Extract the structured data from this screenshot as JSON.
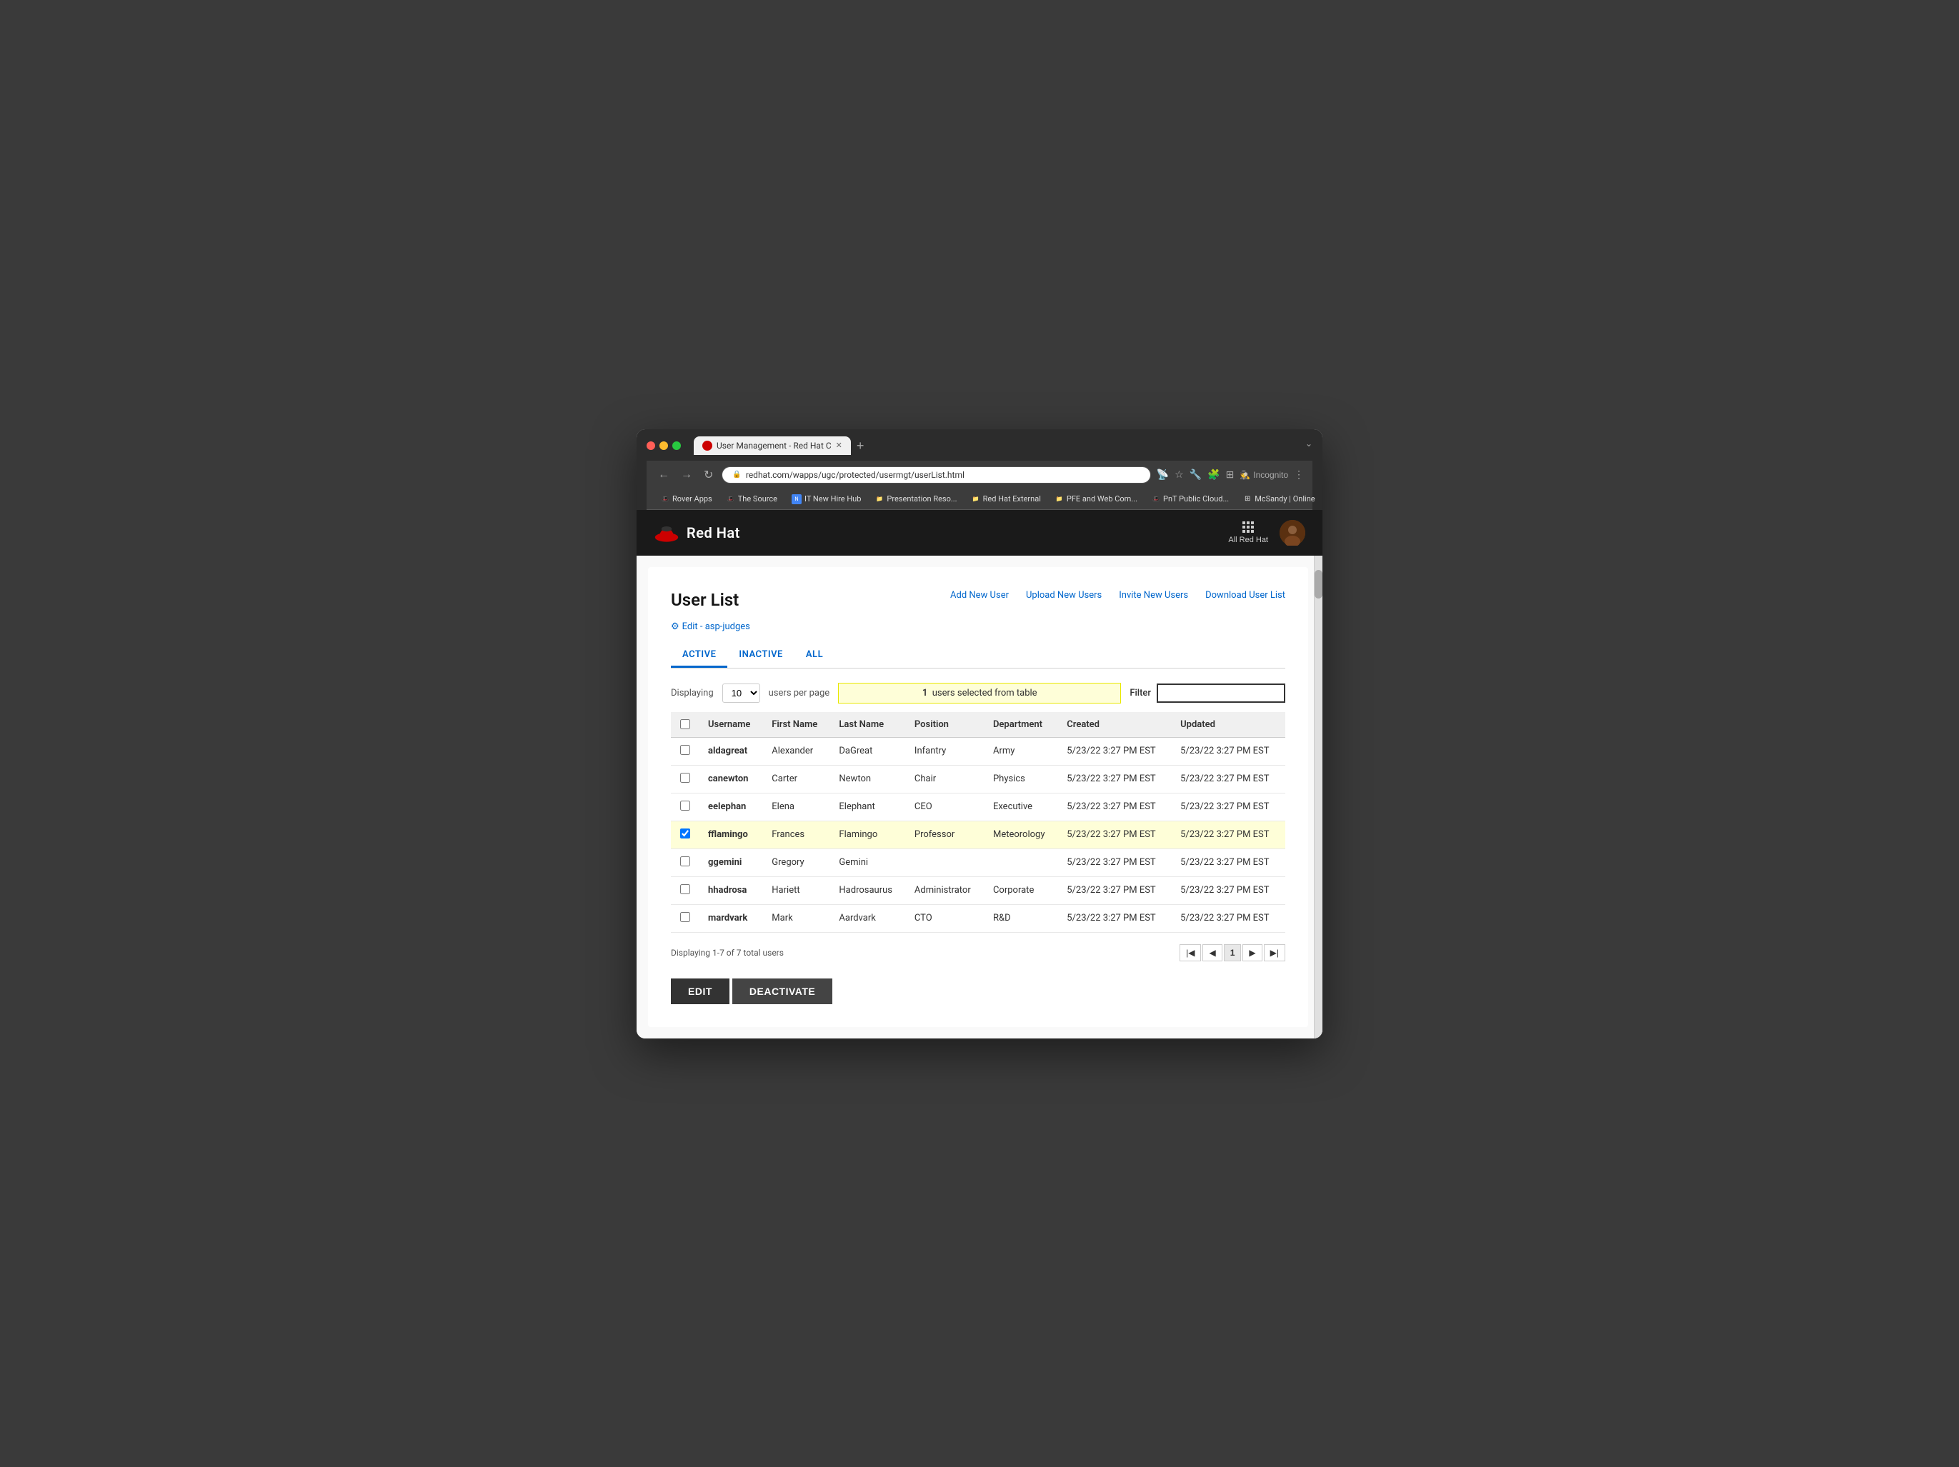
{
  "browser": {
    "tab_title": "User Management - Red Hat C",
    "url": "redhat.com/wapps/ugc/protected/usermgt/userList.html",
    "incognito_label": "Incognito",
    "bookmarks": [
      {
        "label": "Rover Apps",
        "type": "favicon-red"
      },
      {
        "label": "The Source",
        "type": "favicon-red"
      },
      {
        "label": "IT New Hire Hub",
        "type": "new"
      },
      {
        "label": "Presentation Reso...",
        "type": "folder"
      },
      {
        "label": "Red Hat External",
        "type": "folder"
      },
      {
        "label": "PFE and Web Com...",
        "type": "folder"
      },
      {
        "label": "PnT Public Cloud...",
        "type": "favicon-red"
      },
      {
        "label": "McSandy | Online",
        "type": "grid"
      }
    ]
  },
  "header": {
    "logo_text": "Red Hat",
    "all_red_hat_label": "All Red Hat"
  },
  "page": {
    "title": "User List",
    "edit_link": "Edit - asp-judges",
    "action_links": {
      "add": "Add New User",
      "upload": "Upload New Users",
      "invite": "Invite New Users",
      "download": "Download User List"
    },
    "tabs": [
      {
        "label": "ACTIVE",
        "active": true
      },
      {
        "label": "INACTIVE",
        "active": false
      },
      {
        "label": "ALL",
        "active": false
      }
    ]
  },
  "table": {
    "display_label": "Displaying",
    "per_page_value": "10",
    "users_per_page_label": "users per page",
    "selected_banner": "1  users selected from table",
    "filter_label": "Filter",
    "columns": [
      "Username",
      "First Name",
      "Last Name",
      "Position",
      "Department",
      "Created",
      "Updated"
    ],
    "rows": [
      {
        "username": "aldagreat",
        "first": "Alexander",
        "last": "DaGreat",
        "position": "Infantry",
        "department": "Army",
        "created": "5/23/22 3:27 PM EST",
        "updated": "5/23/22 3:27 PM EST",
        "selected": false
      },
      {
        "username": "canewton",
        "first": "Carter",
        "last": "Newton",
        "position": "Chair",
        "department": "Physics",
        "created": "5/23/22 3:27 PM EST",
        "updated": "5/23/22 3:27 PM EST",
        "selected": false
      },
      {
        "username": "eelephan",
        "first": "Elena",
        "last": "Elephant",
        "position": "CEO",
        "department": "Executive",
        "created": "5/23/22 3:27 PM EST",
        "updated": "5/23/22 3:27 PM EST",
        "selected": false
      },
      {
        "username": "fflamingo",
        "first": "Frances",
        "last": "Flamingo",
        "position": "Professor",
        "department": "Meteorology",
        "created": "5/23/22 3:27 PM EST",
        "updated": "5/23/22 3:27 PM EST",
        "selected": true
      },
      {
        "username": "ggemini",
        "first": "Gregory",
        "last": "Gemini",
        "position": "",
        "department": "",
        "created": "5/23/22 3:27 PM EST",
        "updated": "5/23/22 3:27 PM EST",
        "selected": false
      },
      {
        "username": "hhadrosa",
        "first": "Hariett",
        "last": "Hadrosaurus",
        "position": "Administrator",
        "department": "Corporate",
        "created": "5/23/22 3:27 PM EST",
        "updated": "5/23/22 3:27 PM EST",
        "selected": false
      },
      {
        "username": "mardvark",
        "first": "Mark",
        "last": "Aardvark",
        "position": "CTO",
        "department": "R&D",
        "created": "5/23/22 3:27 PM EST",
        "updated": "5/23/22 3:27 PM EST",
        "selected": false
      }
    ],
    "pagination_info": "Displaying 1-7 of 7 total users",
    "current_page": "1"
  },
  "buttons": {
    "edit": "EDIT",
    "deactivate": "DEACTIVATE"
  }
}
